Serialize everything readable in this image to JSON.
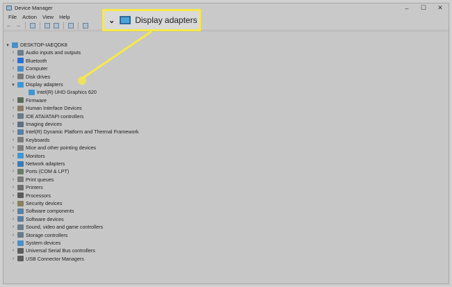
{
  "window": {
    "title": "Device Manager",
    "minimize": "–",
    "maximize": "☐",
    "close": "✕"
  },
  "menu": [
    "File",
    "Action",
    "View",
    "Help"
  ],
  "toolbar": {
    "back": "←",
    "forward": "→"
  },
  "tree": {
    "root": "DESKTOP-IAEQDK8",
    "items": [
      {
        "label": "Audio inputs and outputs",
        "icon_color": "#6e7d8c"
      },
      {
        "label": "Bluetooth",
        "icon_color": "#2a6fd6"
      },
      {
        "label": "Computer",
        "icon_color": "#4a8fc9"
      },
      {
        "label": "Disk drives",
        "icon_color": "#7a7a7a"
      },
      {
        "label": "Display adapters",
        "icon_color": "#3f97d2",
        "expanded": true
      },
      {
        "label": "Intel(R) UHD Graphics 620",
        "icon_color": "#3f97d2",
        "child": true
      },
      {
        "label": "Firmware",
        "icon_color": "#5a6a5a"
      },
      {
        "label": "Human Interface Devices",
        "icon_color": "#8a7c66"
      },
      {
        "label": "IDE ATA/ATAPI controllers",
        "icon_color": "#6a7a8a"
      },
      {
        "label": "Imaging devices",
        "icon_color": "#5d7084"
      },
      {
        "label": "Intel(R) Dynamic Platform and Thermal Framework",
        "icon_color": "#5a7f9f"
      },
      {
        "label": "Keyboards",
        "icon_color": "#7c7c7c"
      },
      {
        "label": "Mice and other pointing devices",
        "icon_color": "#7c7c7c"
      },
      {
        "label": "Monitors",
        "icon_color": "#3f97d2"
      },
      {
        "label": "Network adapters",
        "icon_color": "#3a7ab8"
      },
      {
        "label": "Ports (COM & LPT)",
        "icon_color": "#6a7a6a"
      },
      {
        "label": "Print queues",
        "icon_color": "#7a7a7a"
      },
      {
        "label": "Printers",
        "icon_color": "#6e6e6e"
      },
      {
        "label": "Processors",
        "icon_color": "#5a5a5a"
      },
      {
        "label": "Security devices",
        "icon_color": "#8a8060"
      },
      {
        "label": "Software components",
        "icon_color": "#5a7f9f"
      },
      {
        "label": "Software devices",
        "icon_color": "#5a7f9f"
      },
      {
        "label": "Sound, video and game controllers",
        "icon_color": "#6e7d8c"
      },
      {
        "label": "Storage controllers",
        "icon_color": "#6a7a8a"
      },
      {
        "label": "System devices",
        "icon_color": "#4a8fc9"
      },
      {
        "label": "Universal Serial Bus controllers",
        "icon_color": "#5d5d5d"
      },
      {
        "label": "USB Connector Managers",
        "icon_color": "#5d5d5d"
      }
    ]
  },
  "callout": {
    "label": "Display adapters",
    "highlight_color": "#f7e946"
  }
}
